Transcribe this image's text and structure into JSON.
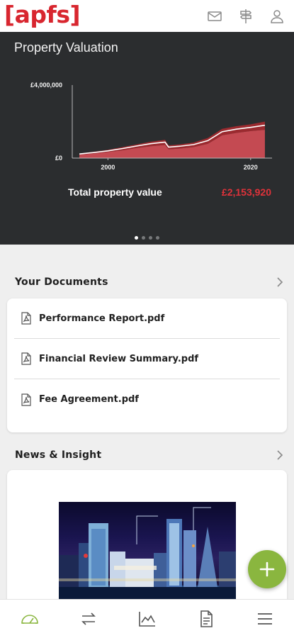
{
  "header": {
    "logo_text": "[apfs]",
    "icons": [
      "mail-icon",
      "signpost-icon",
      "profile-icon"
    ]
  },
  "valuation": {
    "title": "Property Valuation",
    "total_label": "Total property value",
    "total_value": "£2,153,920",
    "carousel": {
      "count": 4,
      "active_index": 0
    },
    "chart_data": {
      "type": "area",
      "y_tick_labels": [
        "£4,000,000",
        "£0"
      ],
      "x_tick_labels": [
        "2000",
        "2020"
      ],
      "ylim": [
        0,
        4000000
      ],
      "xlim": [
        1995,
        2023
      ],
      "colors": {
        "upper_band": "#9b2a2f",
        "lower_band": "#c44a52",
        "line": "#ffffff",
        "background": "#2b2d2f"
      },
      "x": [
        1996,
        1998,
        2000,
        2002,
        2004,
        2006,
        2008,
        2008.5,
        2010,
        2012,
        2014,
        2016,
        2018,
        2020,
        2022
      ],
      "series": [
        {
          "values": [
            250000,
            350000,
            450000,
            600000,
            750000,
            900000,
            1000000,
            700000,
            750000,
            850000,
            1100000,
            1600000,
            1750000,
            1850000,
            2000000
          ]
        },
        {
          "values": [
            200000,
            250000,
            330000,
            420000,
            550000,
            650000,
            720000,
            480000,
            520000,
            600000,
            780000,
            1250000,
            1380000,
            1480000,
            1550000
          ]
        }
      ]
    }
  },
  "documents": {
    "section_title": "Your Documents",
    "items": [
      {
        "name": "Performance Report.pdf"
      },
      {
        "name": "Financial Review Summary.pdf"
      },
      {
        "name": "Fee Agreement.pdf"
      }
    ]
  },
  "news": {
    "section_title": "News & Insight"
  },
  "fab": {
    "icon": "plus-icon",
    "color": "#8ab63f"
  },
  "bottom_nav": {
    "items": [
      "dashboard-icon",
      "transfer-icon",
      "performance-chart-icon",
      "document-icon",
      "menu-icon"
    ],
    "active_index": 0,
    "active_color": "#8ab63f"
  }
}
